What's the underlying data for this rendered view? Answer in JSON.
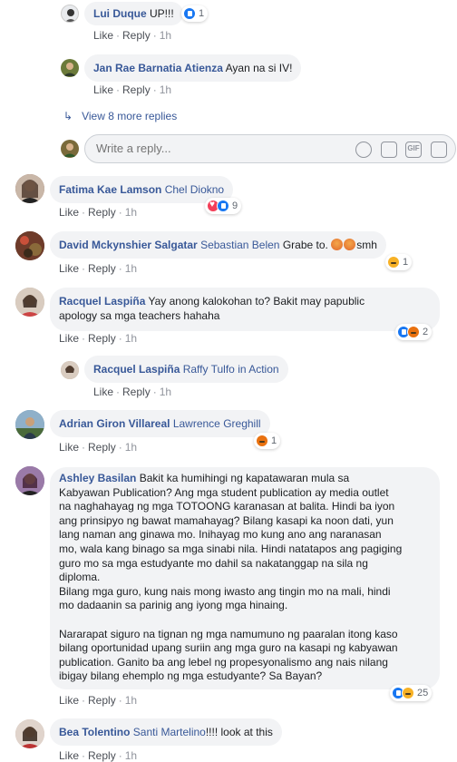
{
  "actions": {
    "like": "Like",
    "reply": "Reply",
    "dot": "·"
  },
  "c1": {
    "name": "Lui Duque",
    "text": "UP!!!",
    "time": "1h",
    "count": "1"
  },
  "c2": {
    "name": "Jan Rae Barnatia Atienza",
    "text": "Ayan na si IV!",
    "time": "1h"
  },
  "view_more": "View 8 more replies",
  "reply_placeholder": "Write a reply...",
  "reply_tools": {
    "gif": "GIF"
  },
  "c3": {
    "name": "Fatima Kae Lamson",
    "mention": "Chel Diokno",
    "time": "1h",
    "count": "9"
  },
  "c4": {
    "name": "David Mckynshier Salgatar",
    "mention": "Sebastian Belen",
    "text": "Grabe to.",
    "text2": "smh",
    "time": "1h",
    "count": "1"
  },
  "c5": {
    "name": "Racquel Laspiña",
    "line1": "Yay anong kalokohan to? Bakit may papublic",
    "line2": "apology sa mga teachers hahaha",
    "time": "1h",
    "count": "2"
  },
  "c6": {
    "name": "Racquel Laspiña",
    "mention": "Raffy Tulfo in Action",
    "time": "1h"
  },
  "c7": {
    "name": "Adrian Giron Villareal",
    "mention": "Lawrence Greghill",
    "time": "1h",
    "count": "1"
  },
  "c8": {
    "name": "Ashley Basilan",
    "lines": [
      "Bakit ka humihingi ng kapatawaran mula sa",
      "Kabyawan Publication? Ang mga student publication ay media outlet",
      "na naghahayag ng mga TOTOONG karanasan at balita. Hindi ba iyon",
      "ang prinsipyo ng bawat mamahayag? Bilang kasapi ka noon dati, yun",
      "lang naman ang ginawa mo. Inihayag mo kung ano ang naranasan",
      "mo, wala kang binago sa mga sinabi nila. Hindi natatapos ang pagiging",
      "guro mo sa mga estudyante mo dahil sa nakatanggap na sila ng",
      "diploma.",
      "Bilang mga guro, kung nais mong iwasto ang tingin mo na mali, hindi",
      "mo dadaanin sa parinig ang iyong mga hinaing.",
      "",
      "Nararapat siguro na tignan ng mga namumuno ng paaralan itong kaso",
      "bilang oportunidad upang suriin ang mga guro na kasapi ng kabyawan",
      "publication. Ganito ba ang lebel ng propesyonalismo ang nais nilang",
      "ibigay bilang ehemplo ng mga estudyante? Sa Bayan?"
    ],
    "time": "1h",
    "count": "25"
  },
  "c9": {
    "name": "Bea Tolentino",
    "mention": "Santi Martelino",
    "text": "!!!! look at this",
    "time": "1h"
  }
}
